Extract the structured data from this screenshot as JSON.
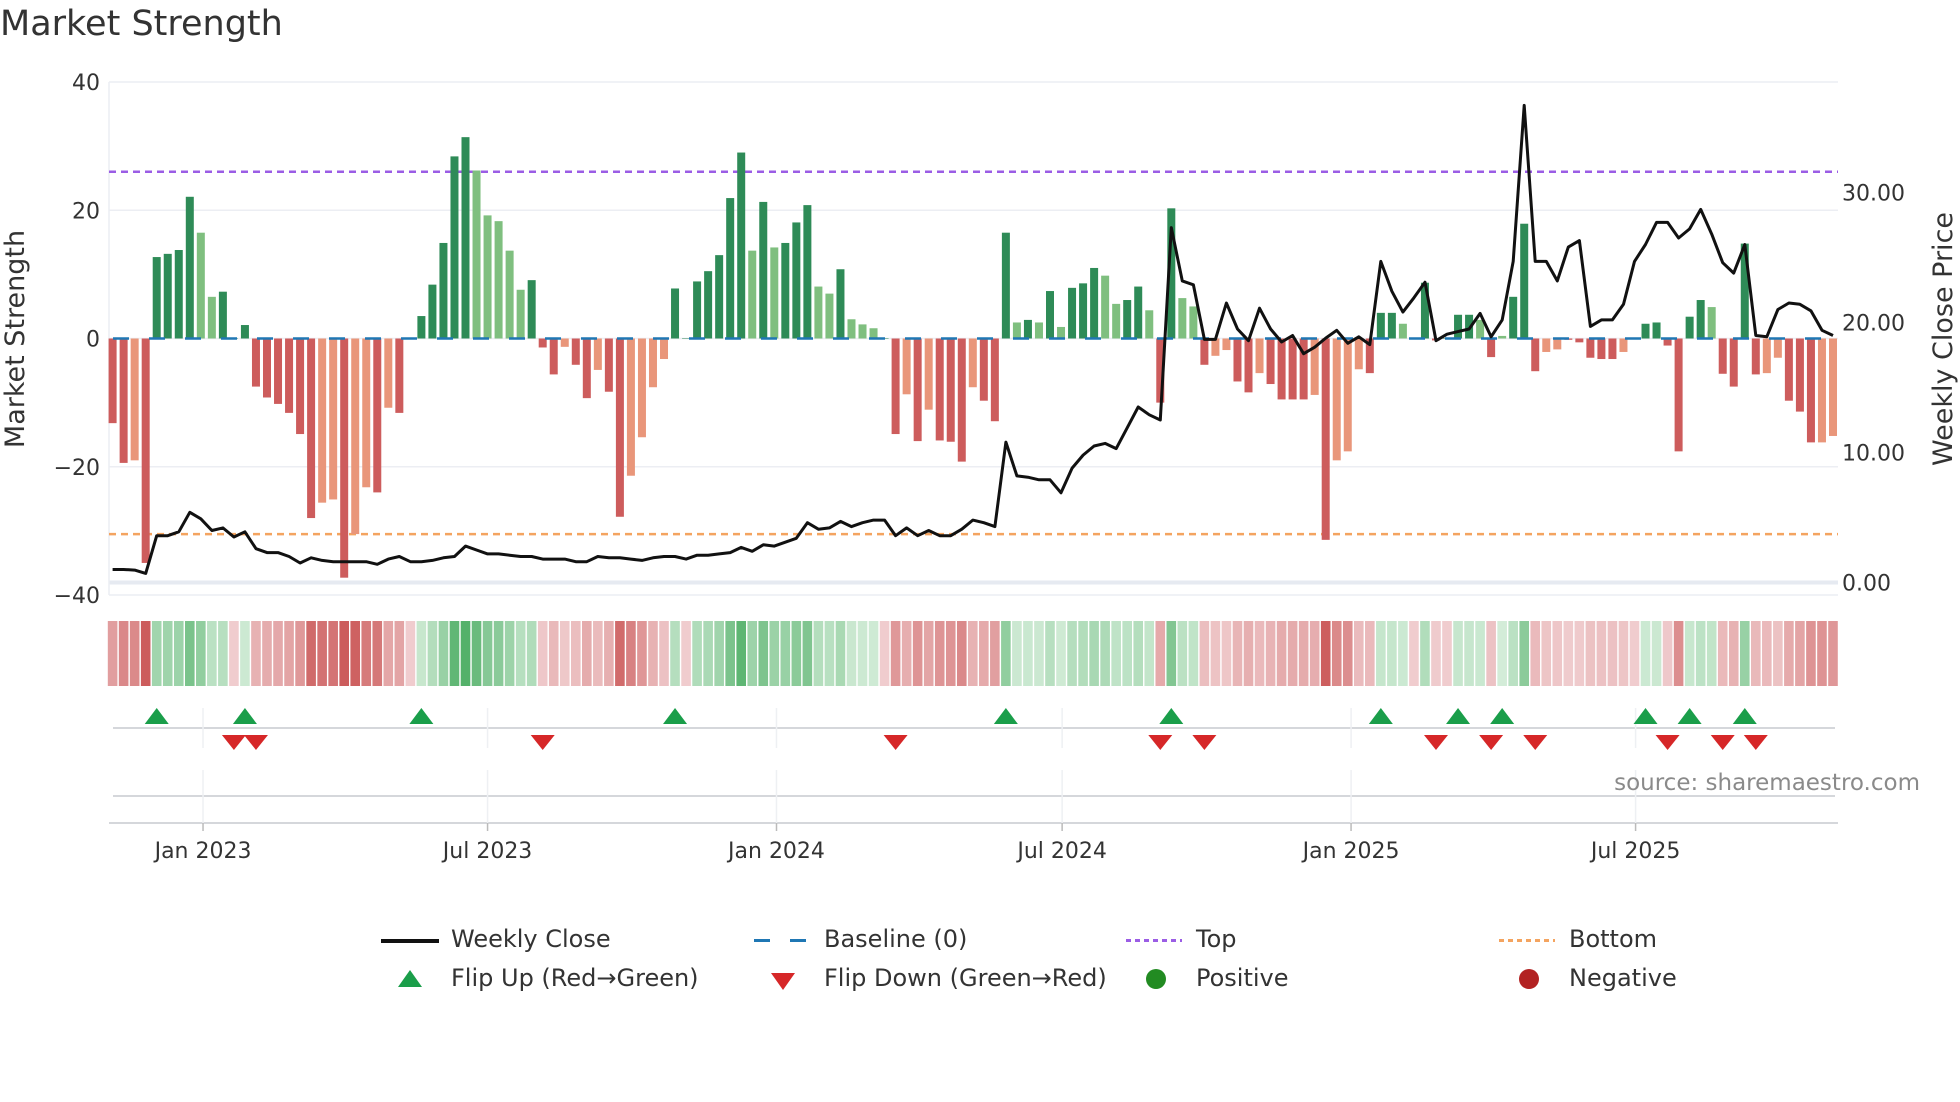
{
  "title": "Market Strength",
  "source": "source: sharemaestro.com",
  "legend": {
    "weekly_close": "Weekly Close",
    "baseline": "Baseline (0)",
    "top": "Top",
    "bottom": "Bottom",
    "flip_up": "Flip Up (Red→Green)",
    "flip_down": "Flip Down (Green→Red)",
    "positive": "Positive",
    "negative": "Negative"
  },
  "colors": {
    "pos_dark": "#2e8b57",
    "pos_light": "#7fbf7f",
    "neg_dark": "#cd5c5c",
    "neg_light": "#e9967a",
    "line": "#111111",
    "baseline": "#1f77b4",
    "top": "#9b5de5",
    "bottom": "#f4a460",
    "flip_up": "#1a9e4a",
    "flip_down": "#d62728",
    "positive": "#228b22",
    "negative": "#b22222"
  },
  "chart_data": {
    "type": "bar",
    "title": "Market Strength",
    "ylabel": "Market Strength",
    "y2label": "Weekly Close Price",
    "ylim": [
      -40,
      40
    ],
    "y2lim": [
      0,
      38.5
    ],
    "yticks": [
      "40",
      "20",
      "0",
      "−20",
      "−40"
    ],
    "yticks_values": [
      40,
      20,
      0,
      -20,
      -40
    ],
    "y2ticks": [
      "30.00",
      "20.00",
      "10.00",
      "0.00"
    ],
    "y2ticks_values": [
      30,
      20,
      10,
      0
    ],
    "top_level": 26,
    "bottom_level": -30.5,
    "x_unit": "week index",
    "xticks": [
      {
        "label": "Jan 2023",
        "week": 8.2
      },
      {
        "label": "Jul 2023",
        "week": 34.0
      },
      {
        "label": "Jan 2024",
        "week": 60.2
      },
      {
        "label": "Jul 2024",
        "week": 86.1
      },
      {
        "label": "Jan 2025",
        "week": 112.3
      },
      {
        "label": "Jul 2025",
        "week": 138.1
      }
    ],
    "strength": [
      -13.2,
      -19.4,
      -19,
      -35,
      12.7,
      13.2,
      13.8,
      22.1,
      16.5,
      6.5,
      7.3,
      0,
      2.1,
      -7.5,
      -9.2,
      -10.2,
      -11.6,
      -14.9,
      -28,
      -25.6,
      -25.1,
      -37.3,
      -30.5,
      -23.2,
      -24,
      -10.8,
      -11.6,
      0,
      3.5,
      8.4,
      14.9,
      28.4,
      31.4,
      26.2,
      19.2,
      18.3,
      13.7,
      7.6,
      9.1,
      -1.4,
      -5.6,
      -1.3,
      -4.1,
      -9.3,
      -4.9,
      -8.3,
      -27.8,
      -21.4,
      -15.4,
      -7.6,
      -3.2,
      7.8,
      0,
      8.9,
      10.5,
      13,
      21.9,
      29,
      13.7,
      21.3,
      14.2,
      14.9,
      18.1,
      20.8,
      8.1,
      7,
      10.8,
      3,
      2.2,
      1.6,
      0,
      -14.9,
      -8.7,
      -16,
      -11.1,
      -15.9,
      -16.1,
      -19.2,
      -7.6,
      -9.7,
      -12.9,
      16.5,
      2.5,
      2.9,
      2.5,
      7.4,
      1.8,
      7.9,
      8.6,
      11,
      9.8,
      5.4,
      6,
      8.1,
      4.4,
      -10,
      20.3,
      6.3,
      5,
      -4.1,
      -2.7,
      -1.8,
      -6.7,
      -8.4,
      -5.4,
      -7.1,
      -9.5,
      -9.5,
      -9.5,
      -8.8,
      -31.4,
      -19,
      -17.6,
      -4.8,
      -5.4,
      4,
      4,
      2.3,
      0,
      8.7,
      -0.3,
      0,
      3.7,
      3.7,
      2.9,
      -2.9,
      0.4,
      6.5,
      17.9,
      -5.1,
      -2.1,
      -1.7,
      -0.2,
      -0.6,
      -3,
      -3.2,
      -3.2,
      -2.1,
      0,
      2.3,
      2.5,
      -1.1,
      -17.6,
      3.4,
      6,
      4.9,
      -5.5,
      -7.5,
      14.8,
      -5.6,
      -5.4,
      -3,
      -9.7,
      -11.4,
      -16.2,
      -16.2,
      -15.2
    ],
    "weakening_weeks": [
      2,
      8,
      9,
      19,
      20,
      22,
      23,
      25,
      33,
      34,
      35,
      36,
      37,
      41,
      44,
      47,
      48,
      49,
      50,
      58,
      60,
      64,
      65,
      67,
      68,
      69,
      72,
      74,
      78,
      82,
      84,
      86,
      90,
      91,
      94,
      97,
      98,
      100,
      101,
      104,
      109,
      111,
      112,
      113,
      117,
      124,
      126,
      130,
      131,
      137,
      145,
      150,
      151,
      155,
      156
    ],
    "weekly_close": [
      1.0,
      1.0,
      0.95,
      0.7,
      3.6,
      3.6,
      3.9,
      5.4,
      4.9,
      4.0,
      4.2,
      3.5,
      3.9,
      2.6,
      2.3,
      2.3,
      2.0,
      1.5,
      1.9,
      1.7,
      1.6,
      1.6,
      1.6,
      1.6,
      1.4,
      1.8,
      2.0,
      1.6,
      1.6,
      1.7,
      1.9,
      2.0,
      2.8,
      2.5,
      2.2,
      2.2,
      2.1,
      2.0,
      2.0,
      1.8,
      1.8,
      1.8,
      1.6,
      1.6,
      2.0,
      1.9,
      1.9,
      1.8,
      1.7,
      1.9,
      2.0,
      2.0,
      1.8,
      2.1,
      2.1,
      2.2,
      2.3,
      2.7,
      2.4,
      2.9,
      2.8,
      3.1,
      3.4,
      4.6,
      4.1,
      4.2,
      4.7,
      4.3,
      4.6,
      4.8,
      4.8,
      3.6,
      4.2,
      3.6,
      4.0,
      3.6,
      3.6,
      4.1,
      4.8,
      4.6,
      4.3,
      10.8,
      8.2,
      8.1,
      7.9,
      7.9,
      6.9,
      8.8,
      9.8,
      10.5,
      10.7,
      10.3,
      11.9,
      13.5,
      12.9,
      12.5,
      27.3,
      23.2,
      22.9,
      18.7,
      18.7,
      21.5,
      19.5,
      18.6,
      21.1,
      19.5,
      18.5,
      19,
      17.6,
      18.1,
      18.8,
      19.4,
      18.4,
      18.9,
      18.3,
      24.7,
      22.4,
      20.8,
      21.9,
      23.1,
      18.6,
      19.1,
      19.3,
      19.5,
      20.7,
      18.9,
      20.2,
      24.7,
      36.7,
      24.7,
      24.7,
      23.2,
      25.8,
      26.3,
      19.7,
      20.2,
      20.2,
      21.4,
      24.7,
      26,
      27.7,
      27.7,
      26.5,
      27.2,
      28.7,
      26.8,
      24.6,
      23.8,
      26,
      19,
      18.9,
      21,
      21.5,
      21.4,
      20.9,
      19.4,
      19
    ],
    "flip_up_weeks": [
      4,
      12,
      28,
      51,
      81,
      96,
      115,
      122,
      126,
      139,
      143,
      148
    ],
    "flip_down_weeks": [
      11,
      13,
      39,
      71,
      95,
      99,
      120,
      125,
      129,
      141,
      146,
      149
    ]
  }
}
